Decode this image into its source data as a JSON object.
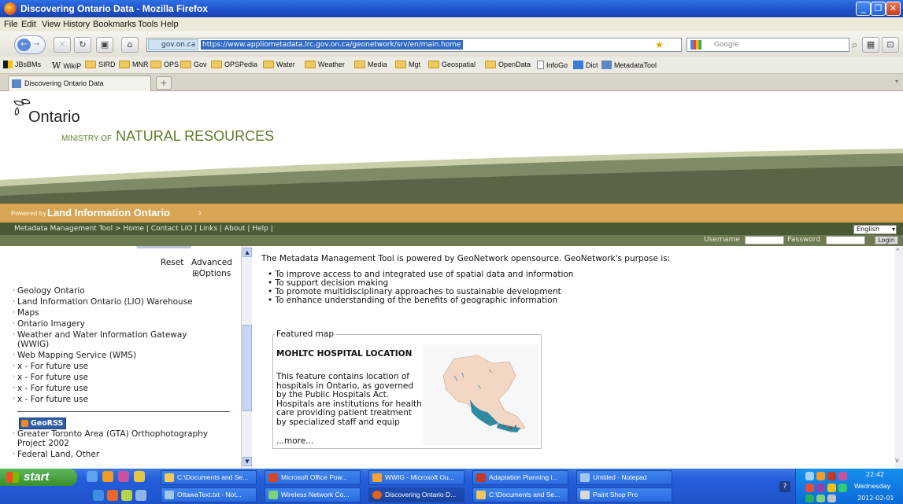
{
  "window": {
    "title": "Discovering Ontario Data - Mozilla Firefox"
  },
  "menu": [
    "File",
    "Edit",
    "View",
    "History",
    "Bookmarks",
    "Tools",
    "Help"
  ],
  "address": {
    "site_badge": "gov.on.ca",
    "url": "https://www.appliometadata.lrc.gov.on.ca/geonetwork/srv/en/main.home",
    "search_placeholder": "Google"
  },
  "bookmarks": [
    "JBsBMs",
    "WikiP",
    "SIRD",
    "MNR",
    "OPS",
    "Gov",
    "OPSPedia",
    "Water",
    "Weather",
    "Media",
    "Mgt",
    "Geospatial",
    "OpenData",
    "InfoGo",
    "Dict",
    "MetadataTool"
  ],
  "tab": {
    "label": "Discovering Ontario Data",
    "new_tab": "+"
  },
  "banner": {
    "ontario": "Ontario",
    "ministry_small": "MINISTRY OF",
    "ministry_big": "NATURAL RESOURCES",
    "powered_by": "Powered by",
    "lio": "Land Information Ontario"
  },
  "breadcrumb": "Metadata Management Tool > Home | Contact LIO | Links | About | Help |",
  "language": "English",
  "login": {
    "username": "Username",
    "password": "Password",
    "button": "Login"
  },
  "sidebar": {
    "reset": "Reset",
    "advanced": "Advanced",
    "options": "⊞Options",
    "items": [
      "Geology Ontario",
      "Land Information Ontario (LIO) Warehouse",
      "Maps",
      "Ontario Imagery",
      "Weather and Water Information Gateway (WWIG)",
      "Web Mapping Service (WMS)",
      "x - For future use",
      "x - For future use",
      "x - For future use",
      "x - For future use"
    ],
    "georss": "GeoRSS",
    "rss_items": [
      "Greater Toronto Area (GTA) Orthophotography Project 2002",
      "Federal Land, Other"
    ]
  },
  "main": {
    "intro": "The Metadata Management Tool is powered by GeoNetwork opensource. GeoNetwork's purpose is:",
    "bullets": [
      "To improve access to and integrated use of spatial data and information",
      "To support decision making",
      "To promote multidisciplinary approaches to sustainable development",
      "To enhance understanding of the benefits of geographic information"
    ],
    "featured_legend": "Featured map",
    "featured_title": "MOHLTC HOSPITAL LOCATION",
    "featured_desc": "This feature contains location of hospitals in Ontario, as governed by the Public Hospitals Act. Hospitals are institutions for health care providing patient treatment by specialized staff and equip",
    "featured_more": "...more..."
  },
  "taskbar": {
    "start": "start",
    "row1": [
      "C:\\Documents and Se...",
      "Microsoft Office Pow...",
      "WWIG - Microsoft Ou...",
      "Adaptation Planning i...",
      "Untitled - Notepad"
    ],
    "row2": [
      "OttawaText.txt - Not...",
      "Wireless Network Co...",
      "Discovering Ontario D...",
      "C:\\Documents and Se...",
      "Paint Shop Pro"
    ],
    "time": "22:42",
    "day": "Wednesday",
    "date": "2012-02-01"
  }
}
